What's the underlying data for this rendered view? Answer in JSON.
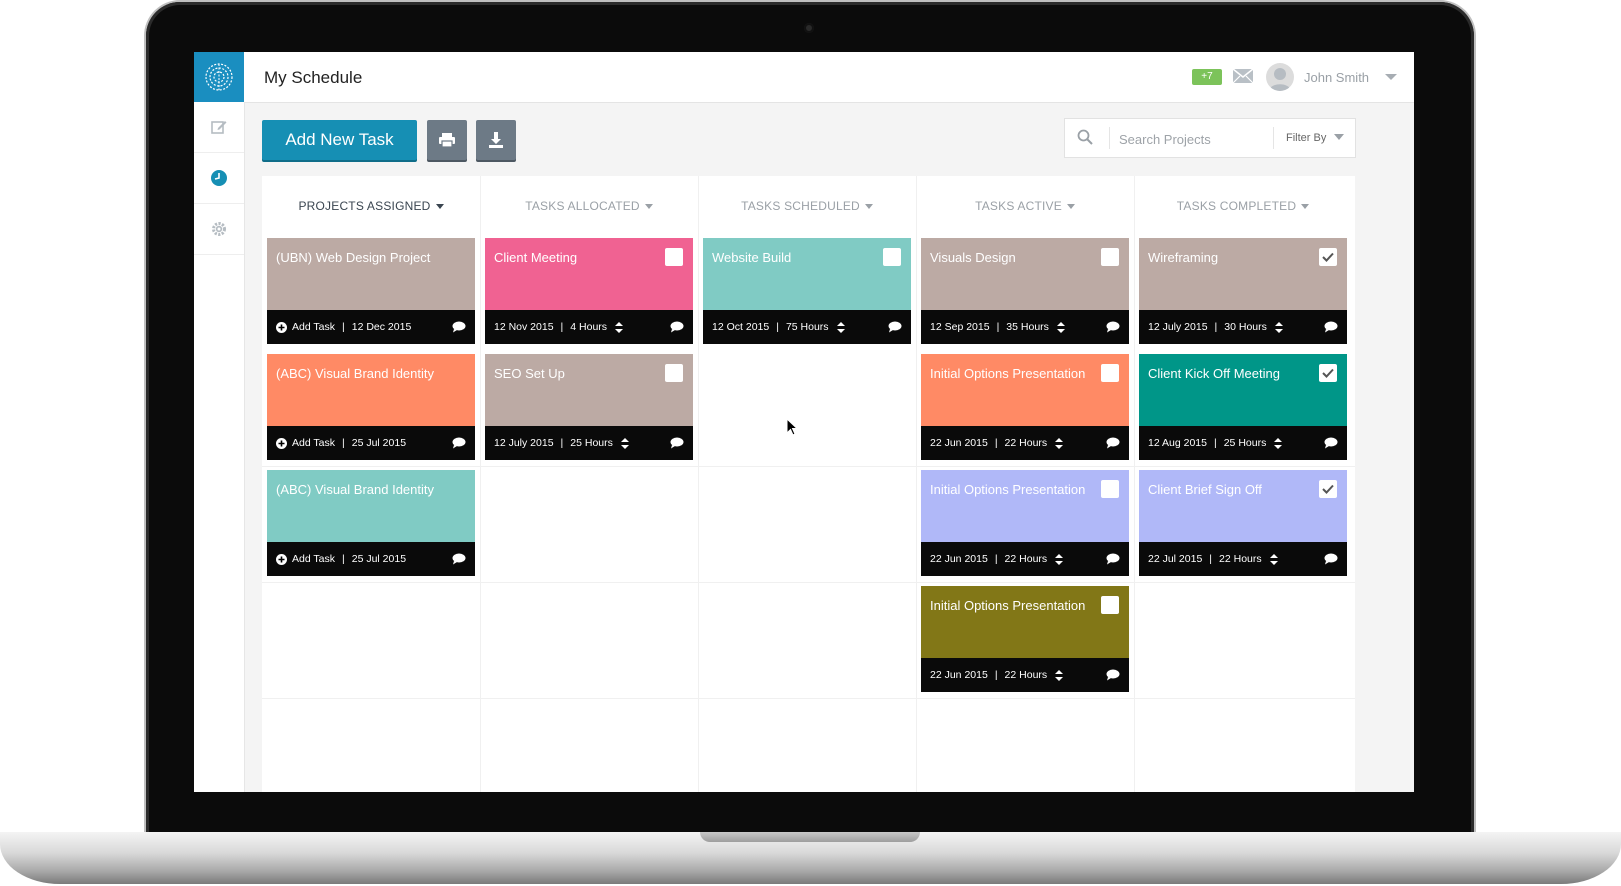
{
  "app": {
    "title": "My Schedule"
  },
  "header": {
    "notification_count": "+7",
    "user_name": "John Smith"
  },
  "toolbar": {
    "add_task_label": "Add New Task",
    "print_icon": "print-icon",
    "download_icon": "download-icon"
  },
  "search": {
    "placeholder": "Search Projects",
    "filter_label": "Filter By"
  },
  "columns": [
    {
      "label": "PROJECTS ASSIGNED"
    },
    {
      "label": "TASKS ALLOCATED"
    },
    {
      "label": "TASKS SCHEDULED"
    },
    {
      "label": "TASKS ACTIVE"
    },
    {
      "label": "TASKS COMPLETED"
    }
  ],
  "cards": {
    "projects": [
      {
        "title": "(UBN) Web Design Project",
        "add": "Add Task",
        "date": "12 Dec 2015",
        "color": "#bcaaa4"
      },
      {
        "title": "(ABC) Visual Brand Identity",
        "add": "Add Task",
        "date": "25 Jul 2015",
        "color": "#ff8a65"
      },
      {
        "title": "(ABC) Visual Brand Identity",
        "add": "Add Task",
        "date": "25 Jul 2015",
        "color": "#80cbc4"
      }
    ],
    "allocated": [
      {
        "title": "Client Meeting",
        "date": "12 Nov 2015",
        "hours": "4 Hours",
        "color": "#f06292"
      },
      {
        "title": "SEO Set Up",
        "date": "12 July 2015",
        "hours": "25 Hours",
        "color": "#bcaaa4"
      }
    ],
    "scheduled": [
      {
        "title": "Website Build",
        "date": "12 Oct 2015",
        "hours": "75 Hours",
        "color": "#80cbc4"
      }
    ],
    "active": [
      {
        "title": "Visuals Design",
        "date": "12 Sep 2015",
        "hours": "35 Hours",
        "color": "#bcaaa4"
      },
      {
        "title": "Initial Options Presentation",
        "date": "22 Jun 2015",
        "hours": "22 Hours",
        "color": "#ff8a65"
      },
      {
        "title": "Initial Options Presentation",
        "date": "22 Jun 2015",
        "hours": "22 Hours",
        "color": "#b0b8f8"
      },
      {
        "title": "Initial Options Presentation",
        "date": "22 Jun 2015",
        "hours": "22 Hours",
        "color": "#827717"
      }
    ],
    "completed": [
      {
        "title": "Wireframing",
        "date": "12 July 2015",
        "hours": "30 Hours",
        "color": "#bcaaa4",
        "checked": true
      },
      {
        "title": "Client Kick Off Meeting",
        "date": "12 Aug 2015",
        "hours": "25 Hours",
        "color": "#009688",
        "checked": true
      },
      {
        "title": "Client Brief Sign Off",
        "date": "22 Jul 2015",
        "hours": "22 Hours",
        "color": "#b0b8f8",
        "checked": true
      }
    ]
  },
  "colors": {
    "accent": "#168fb4",
    "badge": "#7cc35a",
    "footer": "#0a0a0a"
  }
}
